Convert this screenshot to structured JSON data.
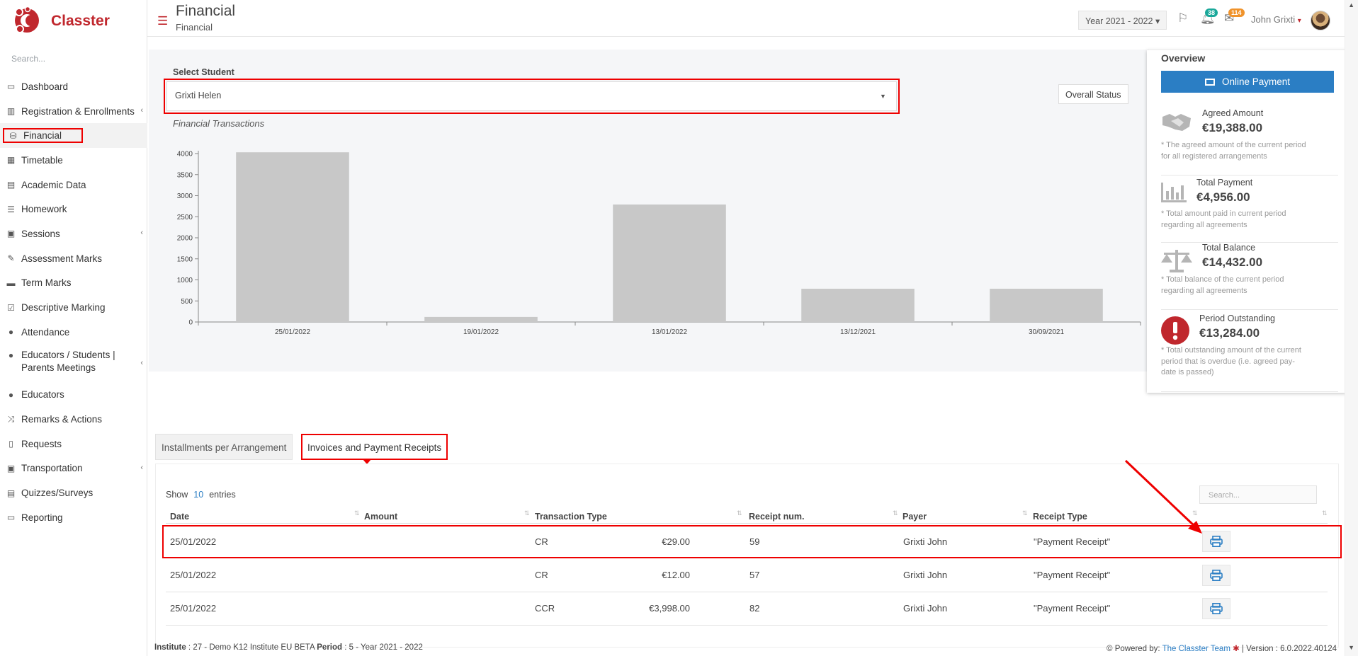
{
  "app": {
    "logo_text": "Classter",
    "search_placeholder": "Search..."
  },
  "sidebar": {
    "items": [
      {
        "label": "Dashboard",
        "icon": "laptop-icon"
      },
      {
        "label": "Registration & Enrollments",
        "icon": "institution-icon",
        "caret": "‹"
      },
      {
        "label": "Financial",
        "icon": "coins-icon"
      },
      {
        "label": "Timetable",
        "icon": "calendar-icon"
      },
      {
        "label": "Academic Data",
        "icon": "id-card-icon"
      },
      {
        "label": "Homework",
        "icon": "list-icon"
      },
      {
        "label": "Sessions",
        "icon": "presentation-icon",
        "caret": "‹"
      },
      {
        "label": "Assessment Marks",
        "icon": "edit-icon"
      },
      {
        "label": "Term Marks",
        "icon": "book-icon"
      },
      {
        "label": "Descriptive Marking",
        "icon": "checklist-icon"
      },
      {
        "label": "Attendance",
        "icon": "user-x-icon"
      },
      {
        "label": "Educators / Students | Parents Meetings",
        "icon": "users-meeting-icon",
        "caret": "‹"
      },
      {
        "label": "Educators",
        "icon": "users-icon"
      },
      {
        "label": "Remarks & Actions",
        "icon": "shuffle-icon"
      },
      {
        "label": "Requests",
        "icon": "file-icon"
      },
      {
        "label": "Transportation",
        "icon": "bus-icon",
        "caret": "‹"
      },
      {
        "label": "Quizzes/Surveys",
        "icon": "clipboard-icon"
      },
      {
        "label": "Reporting",
        "icon": "printer-icon"
      }
    ]
  },
  "header": {
    "title": "Financial",
    "subtitle": "Financial",
    "year": "Year 2021 - 2022",
    "notifications_count": "38",
    "messages_count": "114",
    "user_name": "John Grixti"
  },
  "student_select": {
    "label": "Select Student",
    "value": "Grixti Helen",
    "overall_status": "Overall Status"
  },
  "chart_data": {
    "type": "bar",
    "title": "Financial Transactions",
    "categories": [
      "25/01/2022",
      "19/01/2022",
      "13/01/2022",
      "13/12/2021",
      "30/09/2021"
    ],
    "values": [
      4030,
      120,
      2790,
      790,
      790
    ],
    "yticks": [
      0,
      500,
      1000,
      1500,
      2000,
      2500,
      3000,
      3500,
      4000
    ],
    "ylim": [
      0,
      4000
    ],
    "xlabel": "",
    "ylabel": "",
    "bar_color": "#c8c8c8"
  },
  "overview": {
    "title": "Overview",
    "online_payment": "Online Payment",
    "items": [
      {
        "label": "Agreed Amount",
        "value": "€19,388.00",
        "note": "* The agreed amount of the current period for all registered arrangements",
        "icon": "handshake-icon"
      },
      {
        "label": "Total Payment",
        "value": "€4,956.00",
        "note": "* Total amount paid in current period regarding all agreements",
        "icon": "bar-chart-icon"
      },
      {
        "label": "Total Balance",
        "value": "€14,432.00",
        "note": "* Total balance of the current period regarding all agreements",
        "icon": "balance-scale-icon"
      },
      {
        "label": "Period Outstanding",
        "value": "€13,284.00",
        "note": "* Total outstanding amount of the current period that is overdue (i.e. agreed pay-date is passed)",
        "icon": "exclamation-circle-icon"
      }
    ]
  },
  "tabs": [
    {
      "label": "Installments per Arrangement"
    },
    {
      "label": "Invoices and Payment Receipts"
    }
  ],
  "table": {
    "show": "Show",
    "entries_count": "10",
    "entries": "entries",
    "search_placeholder": "Search...",
    "columns": [
      "Date",
      "Amount",
      "Transaction Type",
      "Receipt num.",
      "Payer",
      "Receipt Type"
    ],
    "rows": [
      {
        "date": "25/01/2022",
        "amount": "€29.00",
        "type": "CR",
        "receipt": "59",
        "payer": "Grixti John",
        "receipt_type": "\"Payment Receipt\""
      },
      {
        "date": "25/01/2022",
        "amount": "€12.00",
        "type": "CR",
        "receipt": "57",
        "payer": "Grixti John",
        "receipt_type": "\"Payment Receipt\""
      },
      {
        "date": "25/01/2022",
        "amount": "€3,998.00",
        "type": "CCR",
        "receipt": "82",
        "payer": "Grixti John",
        "receipt_type": "\"Payment Receipt\""
      }
    ]
  },
  "footer": {
    "institute_label": "Institute",
    "institute_value": " : 27 - Demo K12 Institute EU BETA ",
    "period_label": "Period",
    "period_value": " : 5 - Year 2021 - 2022",
    "powered_by": "Powered by: ",
    "team": "The Classter Team",
    "version": " | Version : 6.0.2022.40124"
  },
  "colors": {
    "brand": "#c0272d",
    "primary": "#2b7ec4",
    "highlight": "#ee0000"
  }
}
